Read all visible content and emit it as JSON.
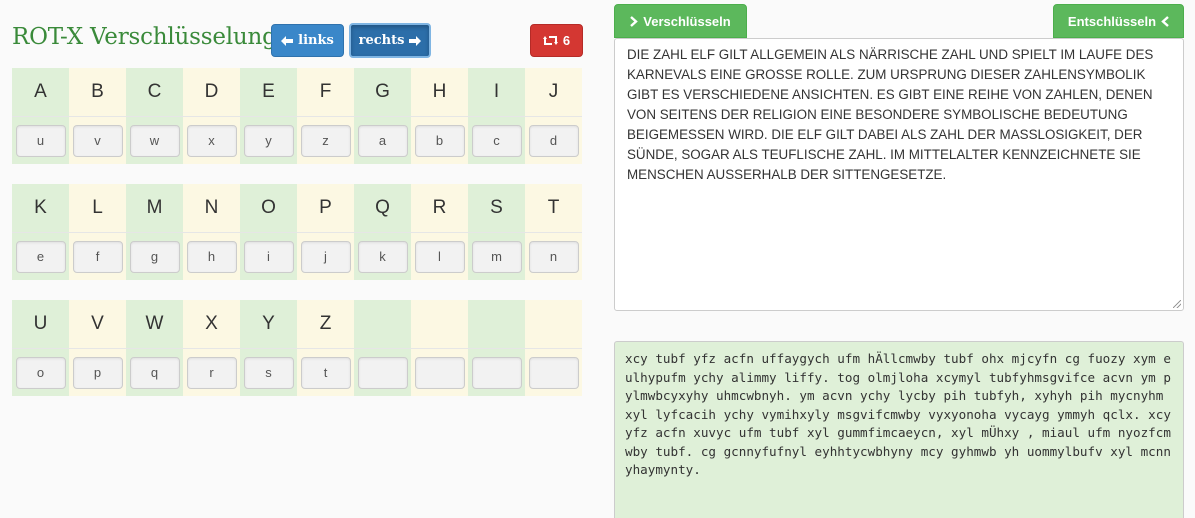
{
  "header": {
    "title": "ROT-X Verschlüsselung",
    "links_label": "links",
    "rechts_label": "rechts",
    "rotation_count": "6"
  },
  "alphabet": {
    "rows": [
      {
        "letters": [
          "A",
          "B",
          "C",
          "D",
          "E",
          "F",
          "G",
          "H",
          "I",
          "J"
        ],
        "mapped": [
          "u",
          "v",
          "w",
          "x",
          "y",
          "z",
          "a",
          "b",
          "c",
          "d"
        ]
      },
      {
        "letters": [
          "K",
          "L",
          "M",
          "N",
          "O",
          "P",
          "Q",
          "R",
          "S",
          "T"
        ],
        "mapped": [
          "e",
          "f",
          "g",
          "h",
          "i",
          "j",
          "k",
          "l",
          "m",
          "n"
        ]
      },
      {
        "letters": [
          "U",
          "V",
          "W",
          "X",
          "Y",
          "Z",
          "",
          "",
          "",
          ""
        ],
        "mapped": [
          "o",
          "p",
          "q",
          "r",
          "s",
          "t",
          "",
          "",
          "",
          ""
        ]
      }
    ]
  },
  "actions": {
    "encrypt_label": "Verschlüsseln",
    "decrypt_label": "Entschlüsseln"
  },
  "plaintext": "DIE ZAHL ELF GILT ALLGEMEIN ALS NÄRRISCHE ZAHL UND SPIELT IM LAUFE DES KARNEVALS EINE GROSSE ROLLE. ZUM URSPRUNG DIESER ZAHLENSYMBOLIK GIBT ES VERSCHIEDENE ANSICHTEN. ES GIBT EINE REIHE VON ZAHLEN, DENEN VON SEITENS DER RELIGION EINE BESONDERE SYMBOLISCHE BEDEUTUNG BEIGEMESSEN WIRD. DIE ELF GILT DABEI ALS ZAHL DER MASSLOSIGKEIT, DER SÜNDE, SOGAR ALS TEUFLISCHE ZAHL. IM MITTELALTER KENNZEICHNETE SIE MENSCHEN AUSSERHALB DER SITTENGESETZE.",
  "ciphertext": "xcy tubf yfz acfn uffaygych ufm hÄllcmwby tubf ohx mjcyfn cg fuozy xym eulhypufm ychy alimmy liffy. tog olmjloha xcymyl tubfyhmsgvifce acvn ym pylmwbcyxyhy uhmcwbnyh. ym acvn ychy lycby pih tubfyh, xyhyh pih mycnyhm xyl lyfcacih ychy vymihxyly msgvifcmwby vyxyonoha vycayg ymmyh qclx. xcy yfz acfn xuvyc ufm tubf xyl gummfimcaeycn, xyl mÜhxy , miaul ufm nyozfcmwby tubf. cg gcnnyfufnyl eyhhtycwbhyny mcy gyhmwb yh uommylbufv xyl mcnnyhaymynty.",
  "colors": {
    "title_green": "#3a8a3a",
    "button_blue": "#3a87c9",
    "button_red": "#d43732",
    "button_green": "#5cb85c",
    "cell_green": "#dff0d8",
    "cell_yellow": "#fcf8e3"
  },
  "icons": {
    "links": "arrow-left-icon",
    "rechts": "arrow-right-icon",
    "rotation": "retweet-icon",
    "encrypt": "chevron-right-icon",
    "decrypt": "chevron-left-icon"
  }
}
